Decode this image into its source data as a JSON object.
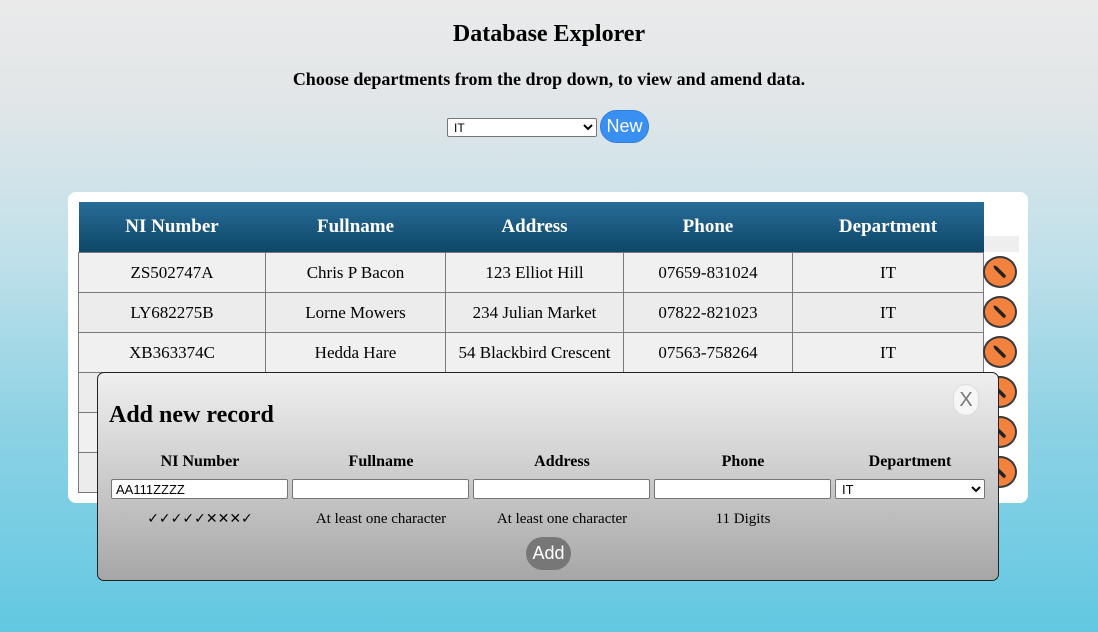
{
  "header": {
    "title": "Database Explorer",
    "subtitle": "Choose departments from the drop down, to view and amend data."
  },
  "controls": {
    "department_selected": "IT",
    "new_label": "New"
  },
  "table": {
    "columns": [
      "NI Number",
      "Fullname",
      "Address",
      "Phone",
      "Department"
    ],
    "rows": [
      [
        "ZS502747A",
        "Chris P Bacon",
        "123 Elliot Hill",
        "07659-831024",
        "IT"
      ],
      [
        "LY682275B",
        "Lorne Mowers",
        "234 Julian Market",
        "07822-821023",
        "IT"
      ],
      [
        "XB363374C",
        "Hedda Hare",
        "54 Blackbird Crescent",
        "07563-758264",
        "IT"
      ],
      [
        "",
        "",
        "",
        "",
        ""
      ],
      [
        "",
        "",
        "",
        "",
        ""
      ],
      [
        "",
        "",
        "",
        "",
        ""
      ]
    ],
    "edit_icon": "pencil-icon"
  },
  "modal": {
    "title": "Add new record",
    "close_label": "X",
    "headers": [
      "NI Number",
      "Fullname",
      "Address",
      "Phone",
      "Department"
    ],
    "fields": {
      "ni_value": "AA111ZZZZ",
      "fullname_value": "",
      "address_value": "",
      "phone_value": "",
      "department_selected": "IT"
    },
    "validation": {
      "ni": "✓✓✓✓✓✕✕✕✓",
      "fullname": "At least one character",
      "address": "At least one character",
      "phone": "11 Digits"
    },
    "add_label": "Add"
  },
  "colors": {
    "header_blue": "#1b5980",
    "edit_orange": "#f4823f",
    "new_blue": "#3a8ff2"
  }
}
